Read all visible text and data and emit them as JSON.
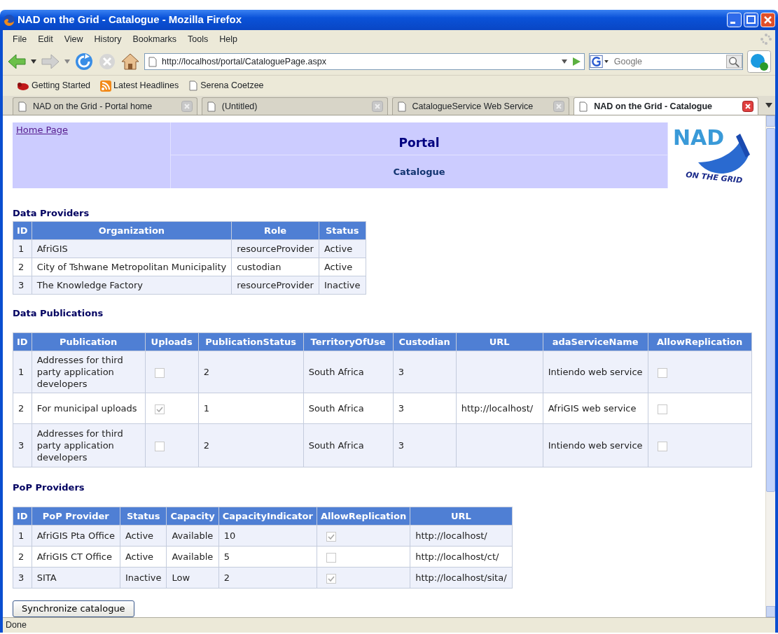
{
  "window": {
    "title": "NAD on the Grid - Catalogue - Mozilla Firefox"
  },
  "menu": [
    "File",
    "Edit",
    "View",
    "History",
    "Bookmarks",
    "Tools",
    "Help"
  ],
  "address_bar": {
    "value": "http://localhost/portal/CataloguePage.aspx"
  },
  "search": {
    "placeholder": "Google"
  },
  "bookmarks": [
    {
      "label": "Getting Started",
      "kind": "star"
    },
    {
      "label": "Latest Headlines",
      "kind": "feed"
    },
    {
      "label": "Serena Coetzee",
      "kind": "page"
    }
  ],
  "tabs": [
    {
      "label": "NAD on the Grid - Portal home",
      "selected": false
    },
    {
      "label": "(Untitled)",
      "selected": false
    },
    {
      "label": "CatalogueService Web Service",
      "selected": false
    },
    {
      "label": "NAD on the Grid - Catalogue",
      "selected": true
    }
  ],
  "page": {
    "home_link": "Home Page",
    "title": "Portal",
    "subtitle": "Catalogue",
    "logo": {
      "top": "NAD",
      "bottom": "ON THE GRID"
    }
  },
  "data_providers": {
    "title": "Data Providers",
    "columns": [
      "ID",
      "Organization",
      "Role",
      "Status"
    ],
    "rows": [
      [
        "1",
        "AfriGIS",
        "resourceProvider",
        "Active"
      ],
      [
        "2",
        "City of Tshwane Metropolitan Municipality",
        "custodian",
        "Active"
      ],
      [
        "3",
        "The Knowledge Factory",
        "resourceProvider",
        "Inactive"
      ]
    ]
  },
  "data_publications": {
    "title": "Data Publications",
    "columns": [
      "ID",
      "Publication",
      "Uploads",
      "PublicationStatus",
      "TerritoryOfUse",
      "Custodian",
      "URL",
      "adaServiceName",
      "AllowReplication"
    ],
    "rows": [
      [
        "1",
        "Addresses for third party application developers",
        {
          "checked": false
        },
        "2",
        "South Africa",
        "3",
        "",
        "Intiendo web service",
        {
          "checked": false
        }
      ],
      [
        "2",
        "For municipal uploads",
        {
          "checked": true
        },
        "1",
        "South Africa",
        "3",
        "http://localhost/",
        "AfriGIS web service",
        {
          "checked": false
        }
      ],
      [
        "3",
        "Addresses for third party application developers",
        {
          "checked": false
        },
        "2",
        "South Africa",
        "3",
        "",
        "Intiendo web service",
        {
          "checked": false
        }
      ]
    ]
  },
  "pop_providers": {
    "title": "PoP Providers",
    "columns": [
      "ID",
      "PoP Provider",
      "Status",
      "Capacity",
      "CapacityIndicator",
      "AllowReplication",
      "URL"
    ],
    "rows": [
      [
        "1",
        "AfriGIS Pta Office",
        "Active",
        "Available",
        "10",
        {
          "checked": true
        },
        "http://localhost/"
      ],
      [
        "2",
        "AfriGIS CT Office",
        "Active",
        "Available",
        "5",
        {
          "checked": false
        },
        "http://localhost/ct/"
      ],
      [
        "3",
        "SITA",
        "Inactive",
        "Low",
        "2",
        {
          "checked": true
        },
        "http://localhost/sita/"
      ]
    ]
  },
  "sync_button": "Synchronize catalogue",
  "status_bar": "Done"
}
